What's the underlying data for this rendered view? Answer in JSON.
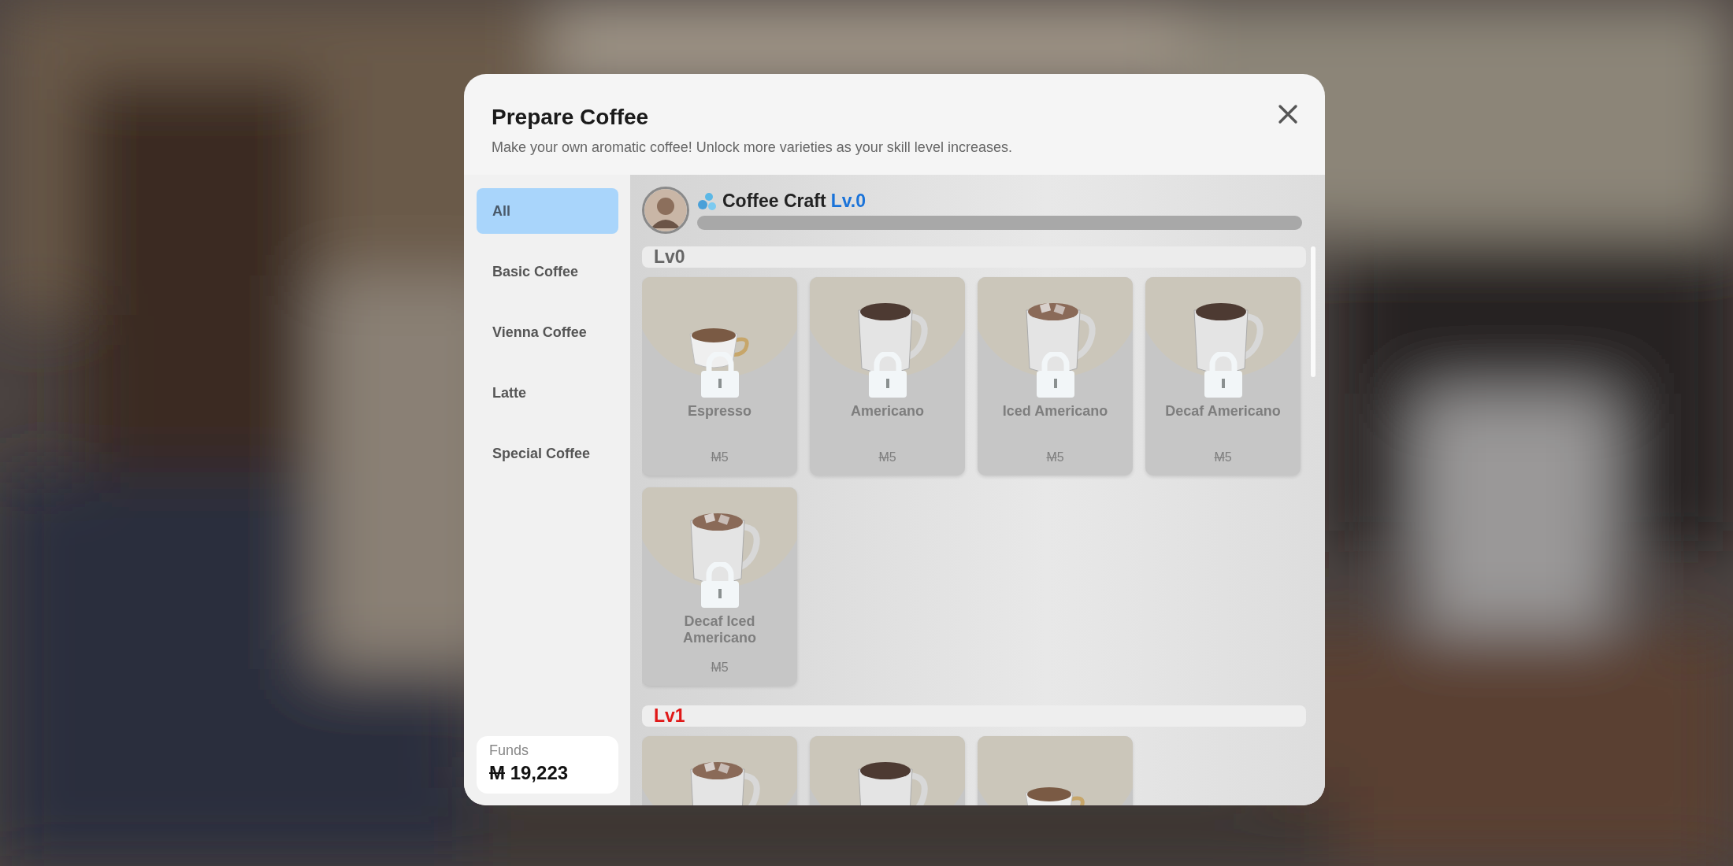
{
  "dialog": {
    "title": "Prepare Coffee",
    "subtitle": "Make your own aromatic coffee! Unlock more varieties as your skill level increases."
  },
  "sidebar": {
    "items": [
      {
        "label": "All",
        "selected": true
      },
      {
        "label": "Basic Coffee",
        "selected": false
      },
      {
        "label": "Vienna Coffee",
        "selected": false
      },
      {
        "label": "Latte",
        "selected": false
      },
      {
        "label": "Special Coffee",
        "selected": false
      }
    ],
    "funds": {
      "label": "Funds",
      "currency": "M",
      "amount": "19,223"
    }
  },
  "skill": {
    "name": "Coffee Craft",
    "level_label": "Lv.0",
    "level": 0
  },
  "sections": [
    {
      "title": "Lv0",
      "reachable": true,
      "cards": [
        {
          "kind": "cup",
          "name": "Espresso",
          "currency": "M",
          "price": "5",
          "locked": true
        },
        {
          "kind": "mug",
          "name": "Americano",
          "currency": "M",
          "price": "5",
          "locked": true
        },
        {
          "kind": "iced",
          "name": "Iced Americano",
          "currency": "M",
          "price": "5",
          "locked": true
        },
        {
          "kind": "mug",
          "name": "Decaf Americano",
          "currency": "M",
          "price": "5",
          "locked": true
        },
        {
          "kind": "iced",
          "name": "Decaf Iced Americano",
          "currency": "M",
          "price": "5",
          "locked": true
        }
      ]
    },
    {
      "title": "Lv1",
      "reachable": false,
      "cards": [
        {
          "kind": "iced"
        },
        {
          "kind": "mug"
        },
        {
          "kind": "cup"
        }
      ]
    }
  ]
}
